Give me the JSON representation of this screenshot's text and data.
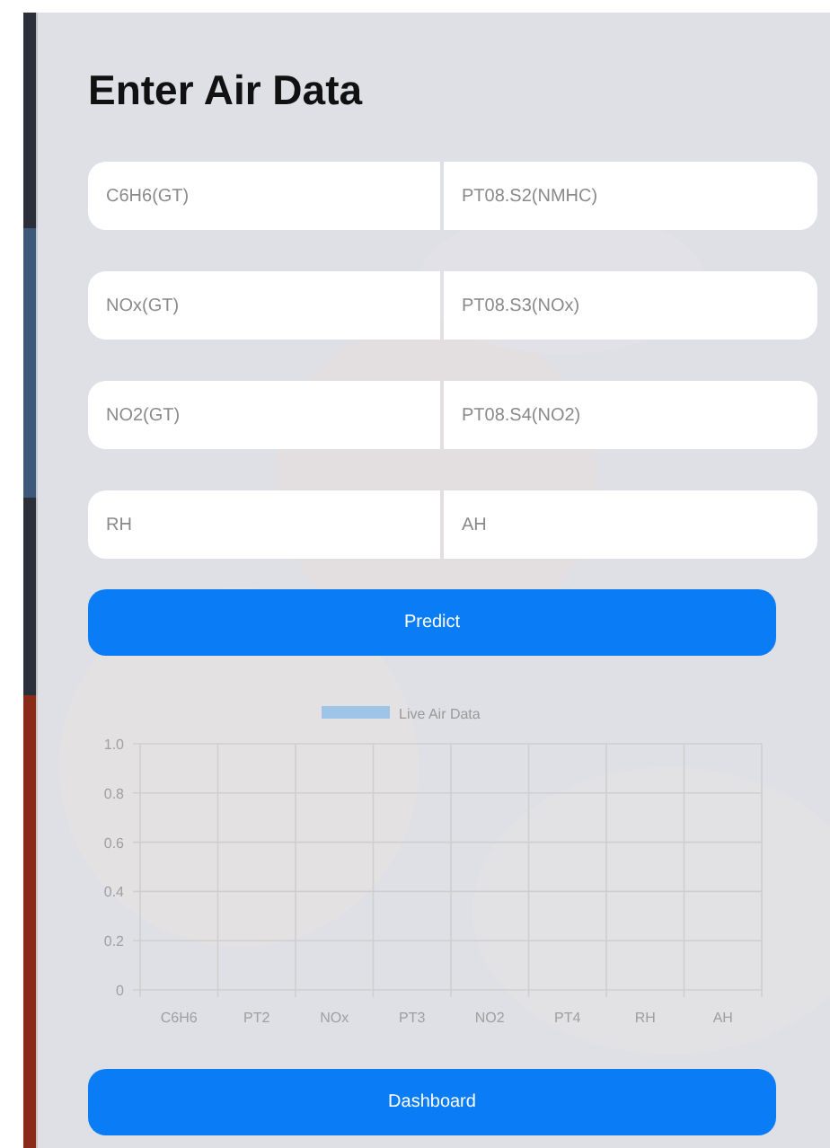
{
  "form": {
    "title": "Enter Air Data",
    "fields": [
      {
        "placeholder": "C6H6(GT)"
      },
      {
        "placeholder": "PT08.S2(NMHC)"
      },
      {
        "placeholder": "NOx(GT)"
      },
      {
        "placeholder": "PT08.S3(NOx)"
      },
      {
        "placeholder": "NO2(GT)"
      },
      {
        "placeholder": "PT08.S4(NO2)"
      },
      {
        "placeholder": "RH"
      },
      {
        "placeholder": "AH"
      }
    ],
    "predict_button": "Predict"
  },
  "chart": {
    "chart_data": {
      "type": "bar",
      "categories": [
        "C6H6",
        "PT2",
        "NOx",
        "PT3",
        "NO2",
        "PT4",
        "RH",
        "AH"
      ],
      "series": [
        {
          "name": "Live Air Data",
          "color": "#9ec5e8",
          "values": [
            null,
            null,
            null,
            null,
            null,
            null,
            null,
            null
          ]
        }
      ],
      "grid": true,
      "ylim": [
        0,
        1
      ],
      "yticks": [
        0,
        0.2,
        0.4,
        0.6,
        0.8,
        {
          "value": 1,
          "label": "1.0"
        }
      ]
    }
  },
  "dashboard_button": "Dashboard"
}
